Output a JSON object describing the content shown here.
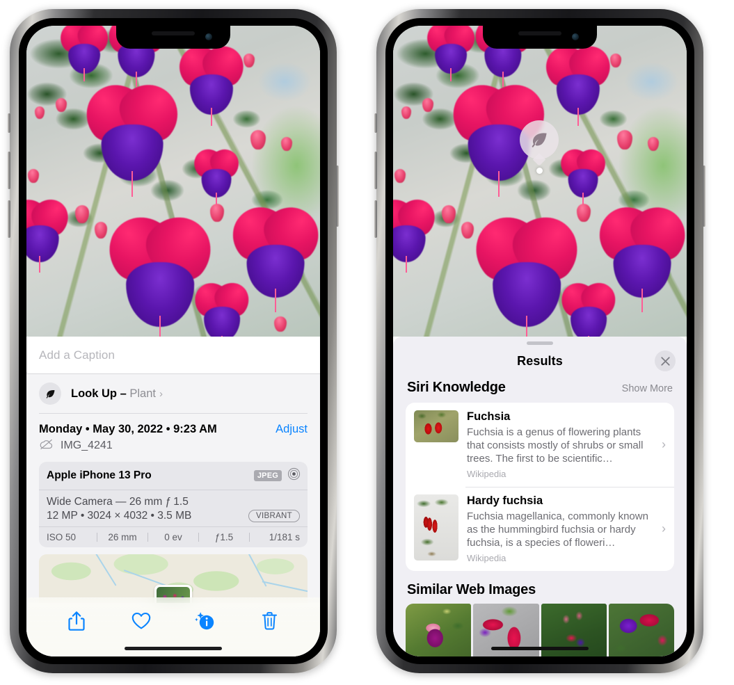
{
  "left_phone": {
    "caption": {
      "placeholder": "Add a Caption",
      "value": ""
    },
    "lookup": {
      "icon": "leaf-icon",
      "sparkle": "sparkle-icon",
      "label": "Look Up – ",
      "subject": "Plant",
      "chevron": "›"
    },
    "details": {
      "date": "Monday • May 30, 2022 • 9:23 AM",
      "adjust_label": "Adjust",
      "cloud_icon": "cloud-slash-icon",
      "file_name": "IMG_4241"
    },
    "camera_card": {
      "device": "Apple iPhone 13 Pro",
      "format_badge": "JPEG",
      "raw_icon": "aperture-icon",
      "lens_line": "Wide Camera — 26 mm ƒ 1.5",
      "size_line": "12 MP • 3024 × 4032 • 3.5 MB",
      "style_badge": "VIBRANT",
      "exif": [
        "ISO 50",
        "26 mm",
        "0 ev",
        "ƒ1.5",
        "1/181 s"
      ]
    },
    "toolbar": [
      {
        "name": "share-button",
        "icon": "share-icon"
      },
      {
        "name": "favorite-button",
        "icon": "heart-icon"
      },
      {
        "name": "info-button",
        "icon": "info-sparkle-icon"
      },
      {
        "name": "delete-button",
        "icon": "trash-icon"
      }
    ]
  },
  "right_phone": {
    "marker": {
      "icon": "leaf-icon"
    },
    "sheet": {
      "title": "Results",
      "close_icon": "close-icon",
      "grabber": "drag-handle"
    },
    "siri_knowledge": {
      "section_title": "Siri Knowledge",
      "show_more": "Show More",
      "items": [
        {
          "title": "Fuchsia",
          "description": "Fuchsia is a genus of flowering plants that consists mostly of shrubs or small trees. The first to be scientific…",
          "source": "Wikipedia",
          "chevron": "›",
          "thumb": "fuchsia-red-flowers-thumbnail"
        },
        {
          "title": "Hardy fuchsia",
          "description": "Fuchsia magellanica, commonly known as the hummingbird fuchsia or hardy fuchsia, is a species of floweri…",
          "source": "Wikipedia",
          "chevron": "›",
          "thumb": "hardy-fuchsia-branch-thumbnail"
        }
      ]
    },
    "similar_web_images": {
      "section_title": "Similar Web Images",
      "items": [
        "pink-purple-fuchsia-leaves",
        "red-fuchsia-closeup",
        "fuchsia-bush-buds",
        "purple-red-fuchsia-cluster"
      ]
    }
  },
  "colors": {
    "accent_blue": "#0a84ff",
    "sheet_bg": "#f0eff4",
    "meta_bg": "#f4f4f6",
    "card_bg": "#e7e7eb",
    "secondary_text": "#8d8d93"
  }
}
